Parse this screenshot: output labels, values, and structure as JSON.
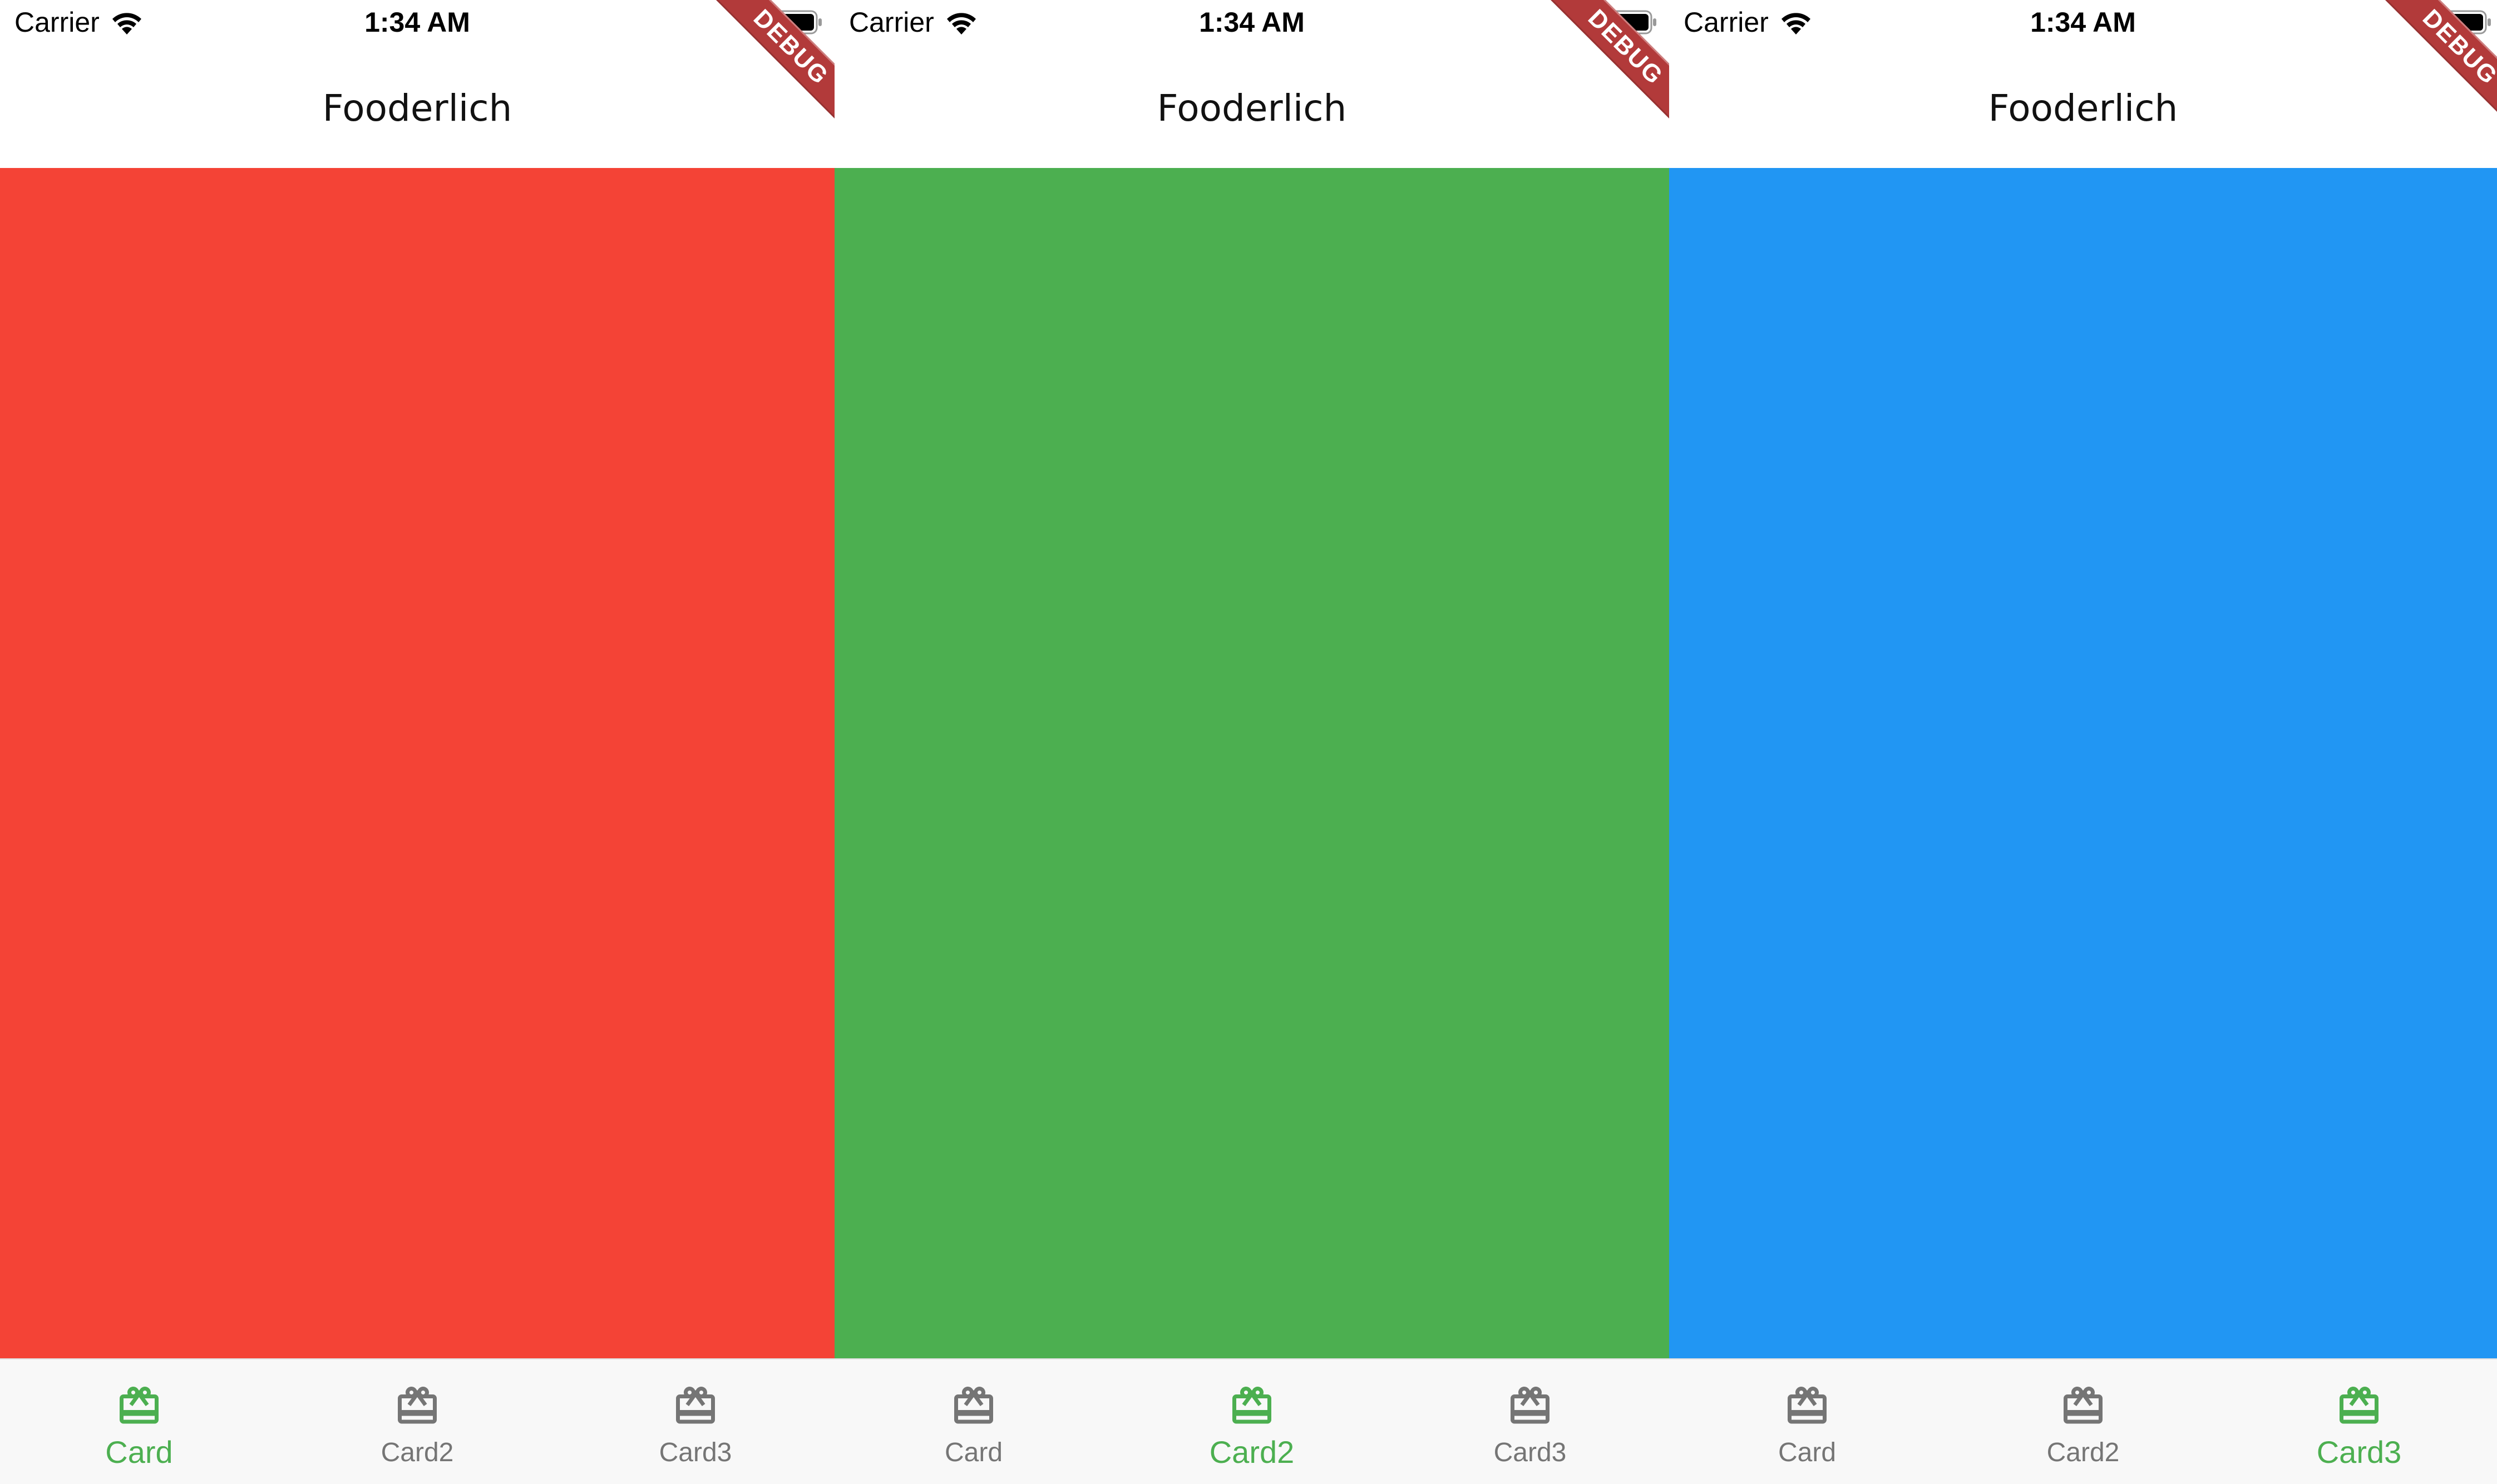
{
  "status_bar": {
    "carrier": "Carrier",
    "time": "1:34 AM"
  },
  "app_bar": {
    "title": "Fooderlich"
  },
  "debug_banner": "DEBUG",
  "colors": {
    "active_tab": "#4caf50",
    "inactive_tab": "#757575",
    "nav_background": "#f8f8f8"
  },
  "screens": [
    {
      "card_color": "#f44336",
      "selected_tab": 0,
      "tabs": [
        {
          "label": "Card",
          "icon": "card-giftcard-icon"
        },
        {
          "label": "Card2",
          "icon": "card-giftcard-icon"
        },
        {
          "label": "Card3",
          "icon": "card-giftcard-icon"
        }
      ]
    },
    {
      "card_color": "#4caf50",
      "selected_tab": 1,
      "tabs": [
        {
          "label": "Card",
          "icon": "card-giftcard-icon"
        },
        {
          "label": "Card2",
          "icon": "card-giftcard-icon"
        },
        {
          "label": "Card3",
          "icon": "card-giftcard-icon"
        }
      ]
    },
    {
      "card_color": "#2196f3",
      "selected_tab": 2,
      "tabs": [
        {
          "label": "Card",
          "icon": "card-giftcard-icon"
        },
        {
          "label": "Card2",
          "icon": "card-giftcard-icon"
        },
        {
          "label": "Card3",
          "icon": "card-giftcard-icon"
        }
      ]
    }
  ]
}
